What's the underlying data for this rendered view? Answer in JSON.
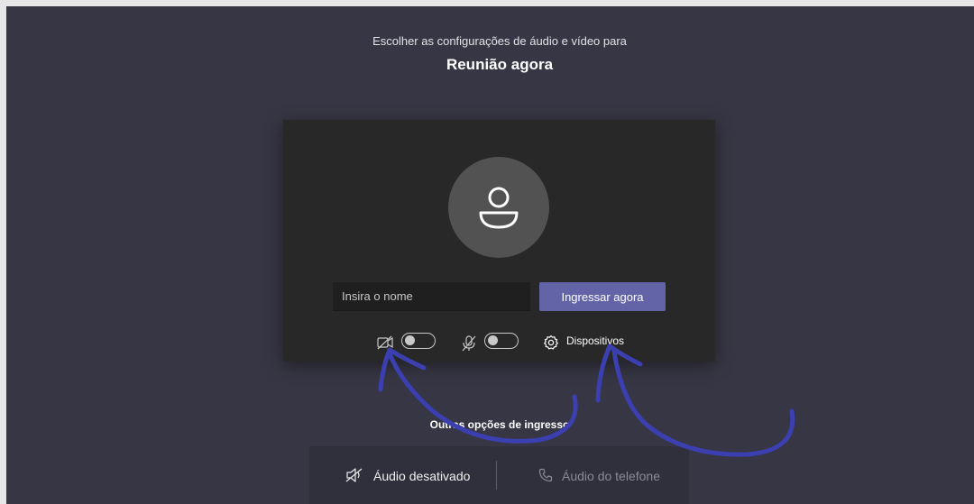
{
  "header": {
    "subtitle": "Escolher as configurações de áudio e vídeo para",
    "meeting_title": "Reunião agora"
  },
  "join_panel": {
    "avatar_icon": "person-icon",
    "name_placeholder": "Insira o nome",
    "join_button_label": "Ingressar agora",
    "camera_toggle": {
      "icon": "camera-off-icon",
      "state": "off"
    },
    "mic_toggle": {
      "icon": "mic-off-icon",
      "state": "off"
    },
    "devices_label": "Dispositivos",
    "devices_icon": "gear-icon"
  },
  "other_options": {
    "label": "Outras opções de ingresso",
    "audio_off_label": "Áudio desativado",
    "audio_off_icon": "speaker-off-icon",
    "phone_audio_label": "Áudio do telefone",
    "phone_audio_icon": "phone-icon"
  },
  "annotations": {
    "arrow_color": "#3b3fb0",
    "arrow_count": 2
  },
  "colors": {
    "background": "#373644",
    "panel": "#292828",
    "accent": "#6264a7"
  }
}
